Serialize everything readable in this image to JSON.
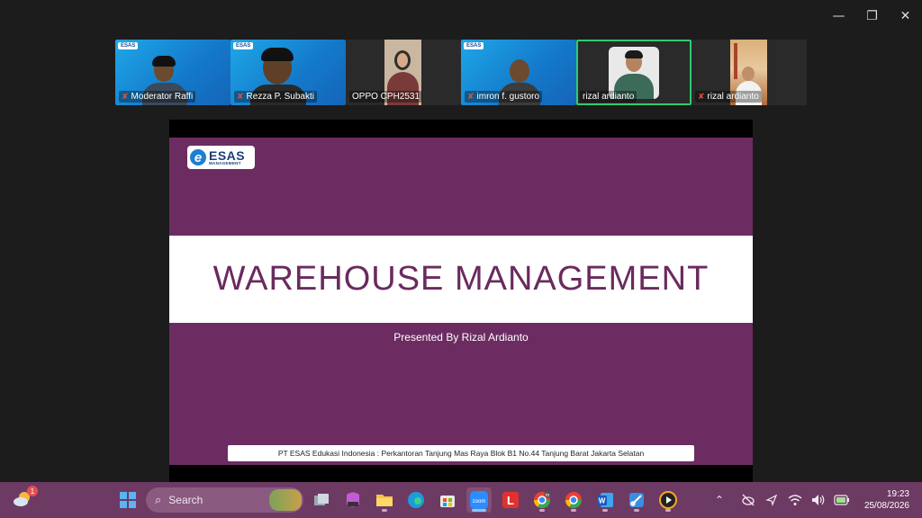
{
  "window": {
    "minimize_icon": "minimize-icon",
    "restore_icon": "restore-icon",
    "close_icon": "close-icon"
  },
  "participants": [
    {
      "name": "Moderator Raffi",
      "muted": true,
      "background": "esas"
    },
    {
      "name": "Rezza P. Subakti",
      "muted": true,
      "background": "esas"
    },
    {
      "name": "OPPO CPH2531",
      "muted": false,
      "background": "dark"
    },
    {
      "name": "imron f. gustoro",
      "muted": true,
      "background": "esas"
    },
    {
      "name": "rizal ardianto",
      "muted": false,
      "background": "dark",
      "active_speaker": true
    },
    {
      "name": "rizal ardianto",
      "muted": true,
      "background": "dark"
    }
  ],
  "slide": {
    "logo_main": "ESAS",
    "logo_sub": "MANAGEMENT",
    "logo_mark": "e",
    "title": "WAREHOUSE MANAGEMENT",
    "presented_by": "Presented By Rizal Ardianto",
    "footer": "PT ESAS Edukasi Indonesia : Perkantoran Tanjung Mas Raya Blok B1 No.44 Tanjung Barat Jakarta Selatan",
    "colors": {
      "primary": "#6c2c62",
      "title": "#6a2a5f",
      "logo_blue": "#1d7fd1"
    }
  },
  "taskbar": {
    "weather_badge": "1",
    "search_label": "Search",
    "apps": [
      "start-icon",
      "search",
      "task-view-icon",
      "copilot-m365-icon",
      "file-explorer-icon",
      "edge-icon",
      "microsoft-store-icon",
      "zoom-icon",
      "l-app-icon",
      "chrome-profile-m-icon",
      "chrome-icon",
      "word-icon",
      "snipping-tool-icon",
      "media-player-icon"
    ],
    "zoom_label": "zoom",
    "l_label": "L",
    "word_label": "W",
    "chrome_badge": "m",
    "clock_time": "19:23",
    "clock_date": "25/08/2026"
  }
}
